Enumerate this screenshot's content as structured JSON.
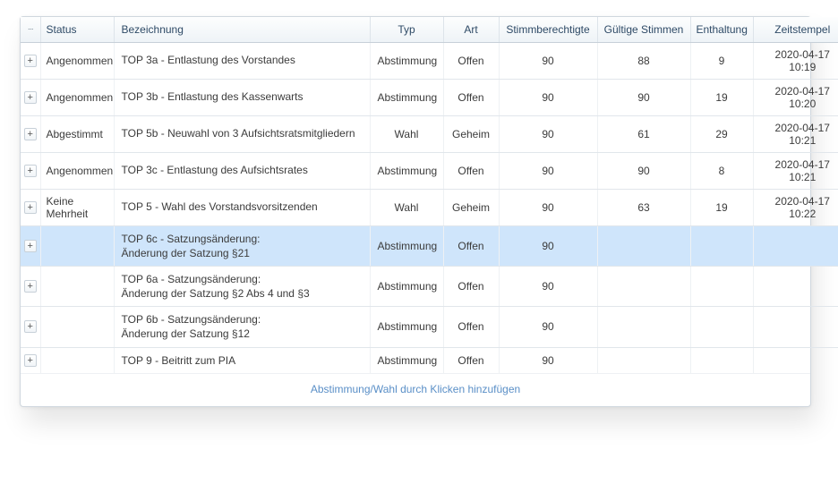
{
  "headers": {
    "menu": "···",
    "status": "Status",
    "bezeichnung": "Bezeichnung",
    "typ": "Typ",
    "art": "Art",
    "stimmberechtigte": "Stimmberechtigte",
    "gueltige": "Gültige Stimmen",
    "enthaltung": "Enthaltung",
    "zeitstempel": "Zeitstempel"
  },
  "expand_glyph": "+",
  "rows": [
    {
      "selected": false,
      "status": "Angenommen",
      "bezeichnung": "TOP 3a - Entlastung des Vorstandes",
      "bezeichnung2": "",
      "typ": "Abstimmung",
      "art": "Offen",
      "stimmberechtigte": "90",
      "gueltige": "88",
      "enthaltung": "9",
      "zeitstempel": "2020-04-17 10:19"
    },
    {
      "selected": false,
      "status": "Angenommen",
      "bezeichnung": "TOP 3b - Entlastung des Kassenwarts",
      "bezeichnung2": "",
      "typ": "Abstimmung",
      "art": "Offen",
      "stimmberechtigte": "90",
      "gueltige": "90",
      "enthaltung": "19",
      "zeitstempel": "2020-04-17 10:20"
    },
    {
      "selected": false,
      "status": "Abgestimmt",
      "bezeichnung": "TOP 5b - Neuwahl von 3 Aufsichtsratsmitgliedern",
      "bezeichnung2": "",
      "typ": "Wahl",
      "art": "Geheim",
      "stimmberechtigte": "90",
      "gueltige": "61",
      "enthaltung": "29",
      "zeitstempel": "2020-04-17 10:21"
    },
    {
      "selected": false,
      "status": "Angenommen",
      "bezeichnung": "TOP 3c - Entlastung des Aufsichtsrates",
      "bezeichnung2": "",
      "typ": "Abstimmung",
      "art": "Offen",
      "stimmberechtigte": "90",
      "gueltige": "90",
      "enthaltung": "8",
      "zeitstempel": "2020-04-17 10:21"
    },
    {
      "selected": false,
      "status": "Keine Mehrheit",
      "bezeichnung": "TOP 5 - Wahl des Vorstandsvorsitzenden",
      "bezeichnung2": "",
      "typ": "Wahl",
      "art": "Geheim",
      "stimmberechtigte": "90",
      "gueltige": "63",
      "enthaltung": "19",
      "zeitstempel": "2020-04-17 10:22"
    },
    {
      "selected": true,
      "status": "",
      "bezeichnung": "TOP 6c - Satzungsänderung:",
      "bezeichnung2": "Änderung der Satzung §21",
      "typ": "Abstimmung",
      "art": "Offen",
      "stimmberechtigte": "90",
      "gueltige": "",
      "enthaltung": "",
      "zeitstempel": ""
    },
    {
      "selected": false,
      "status": "",
      "bezeichnung": "TOP 6a - Satzungsänderung:",
      "bezeichnung2": "Änderung der Satzung §2 Abs 4 und §3",
      "typ": "Abstimmung",
      "art": "Offen",
      "stimmberechtigte": "90",
      "gueltige": "",
      "enthaltung": "",
      "zeitstempel": ""
    },
    {
      "selected": false,
      "status": "",
      "bezeichnung": "TOP 6b - Satzungsänderung:",
      "bezeichnung2": "Änderung der Satzung §12",
      "typ": "Abstimmung",
      "art": "Offen",
      "stimmberechtigte": "90",
      "gueltige": "",
      "enthaltung": "",
      "zeitstempel": ""
    },
    {
      "selected": false,
      "status": "",
      "bezeichnung": "TOP 9 - Beitritt zum PIA",
      "bezeichnung2": "",
      "typ": "Abstimmung",
      "art": "Offen",
      "stimmberechtigte": "90",
      "gueltige": "",
      "enthaltung": "",
      "zeitstempel": ""
    }
  ],
  "add_row_text": "Abstimmung/Wahl durch Klicken hinzufügen"
}
